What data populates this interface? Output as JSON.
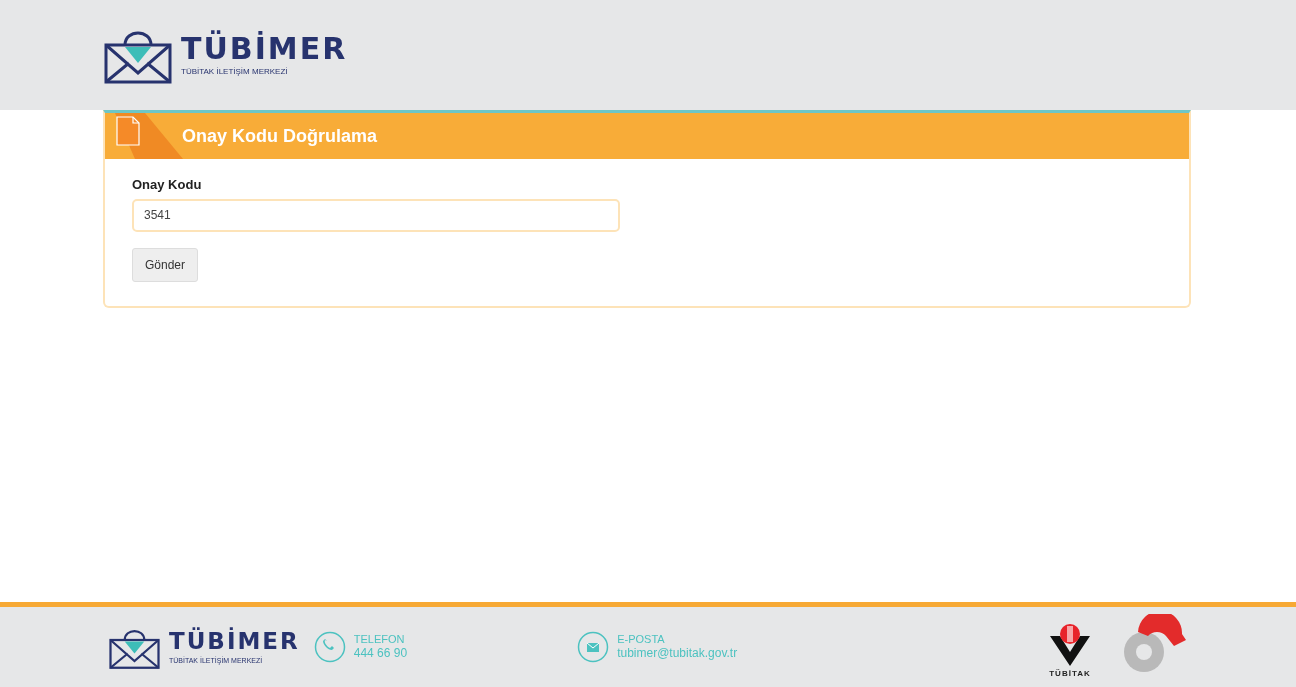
{
  "header": {
    "logo": {
      "name": "TÜBİMER",
      "tagline": "TÜBİTAK İLETİŞİM MERKEZİ"
    }
  },
  "panel": {
    "title": "Onay Kodu Doğrulama",
    "field": {
      "label": "Onay Kodu",
      "value": "3541"
    },
    "button": "Gönder"
  },
  "footer": {
    "logo": {
      "name": "TÜBİMER",
      "tagline": "TÜBİTAK İLETİŞİM MERKEZİ"
    },
    "contacts": [
      {
        "kind": "phone",
        "label": "TELEFON",
        "value": "444 66 90"
      },
      {
        "kind": "email",
        "label": "E-POSTA",
        "value": "tubimer@tubitak.gov.tr"
      }
    ],
    "partner_logo": {
      "caption": "TÜBİTAK"
    }
  }
}
